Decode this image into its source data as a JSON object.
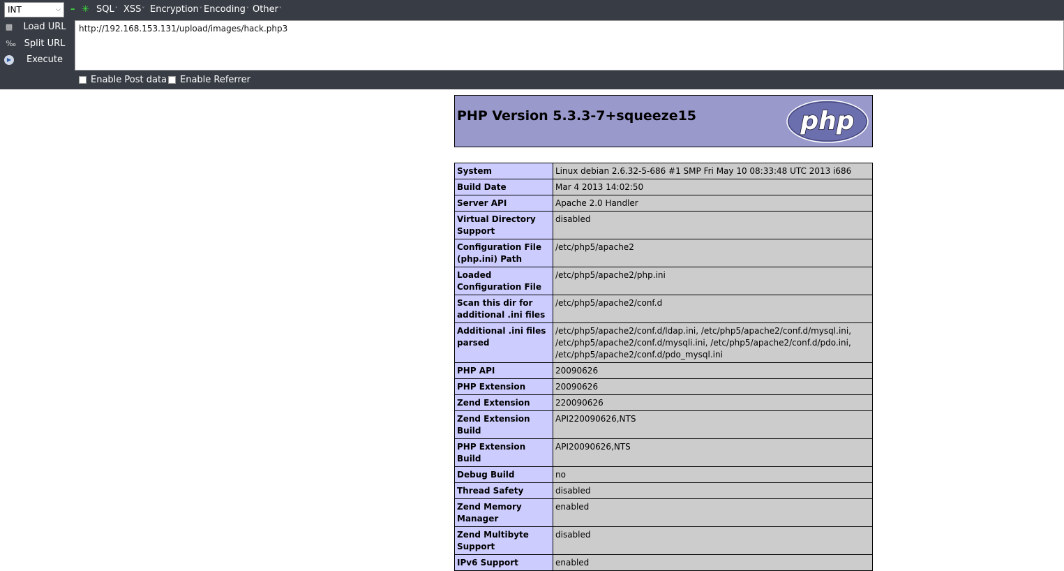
{
  "hackbar": {
    "mode_select": "INT",
    "menus": [
      "SQL",
      "XSS",
      "Encryption",
      "Encoding",
      "Other"
    ],
    "actions": {
      "load_url": "Load URL",
      "split_url": "Split URL",
      "execute": "Execute"
    },
    "url": "http://192.168.153.131/upload/images/hack.php3",
    "options": {
      "enable_post_data": "Enable Post data",
      "enable_referrer": "Enable Referrer"
    },
    "icons": [
      "minus-icon",
      "plus-icon",
      "load-icon",
      "split-icon",
      "execute-icon"
    ],
    "colors": {
      "toolbar_bg": "#383d45",
      "icon_green": "#3ddc3d"
    }
  },
  "phpinfo": {
    "title": "PHP Version 5.3.3-7+squeeze15",
    "logo_text": "php",
    "colors": {
      "header_bg": "#9999cc",
      "key_bg": "#ccccff",
      "value_bg": "#cccccc"
    },
    "rows": [
      {
        "key": "System",
        "value": "Linux debian 2.6.32-5-686 #1 SMP Fri May 10 08:33:48 UTC 2013 i686"
      },
      {
        "key": "Build Date",
        "value": "Mar 4 2013 14:02:50"
      },
      {
        "key": "Server API",
        "value": "Apache 2.0 Handler"
      },
      {
        "key": "Virtual Directory Support",
        "value": "disabled"
      },
      {
        "key": "Configuration File (php.ini) Path",
        "value": "/etc/php5/apache2"
      },
      {
        "key": "Loaded Configuration File",
        "value": "/etc/php5/apache2/php.ini"
      },
      {
        "key": "Scan this dir for additional .ini files",
        "value": "/etc/php5/apache2/conf.d"
      },
      {
        "key": "Additional .ini files parsed",
        "value": "/etc/php5/apache2/conf.d/ldap.ini, /etc/php5/apache2/conf.d/mysql.ini, /etc/php5/apache2/conf.d/mysqli.ini, /etc/php5/apache2/conf.d/pdo.ini, /etc/php5/apache2/conf.d/pdo_mysql.ini"
      },
      {
        "key": "PHP API",
        "value": "20090626"
      },
      {
        "key": "PHP Extension",
        "value": "20090626"
      },
      {
        "key": "Zend Extension",
        "value": "220090626"
      },
      {
        "key": "Zend Extension Build",
        "value": "API220090626,NTS"
      },
      {
        "key": "PHP Extension Build",
        "value": "API20090626,NTS"
      },
      {
        "key": "Debug Build",
        "value": "no"
      },
      {
        "key": "Thread Safety",
        "value": "disabled"
      },
      {
        "key": "Zend Memory Manager",
        "value": "enabled"
      },
      {
        "key": "Zend Multibyte Support",
        "value": "disabled"
      },
      {
        "key": "IPv6 Support",
        "value": "enabled"
      }
    ]
  }
}
